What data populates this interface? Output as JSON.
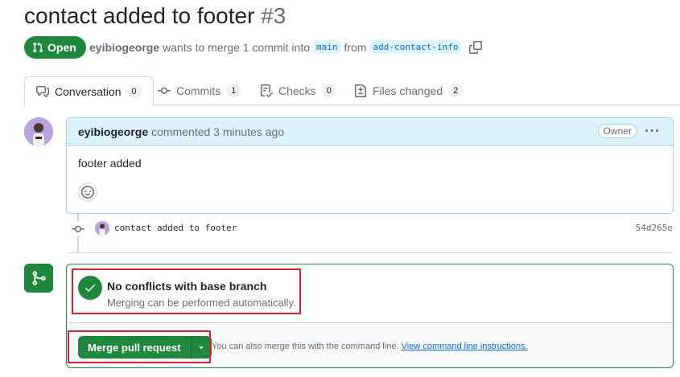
{
  "pr": {
    "title": "contact added to footer",
    "number": "#3",
    "state": "Open",
    "author": "eyibiogeorge",
    "merge_text": "wants to merge 1 commit into",
    "base_branch": "main",
    "from_text": "from",
    "head_branch": "add-contact-info"
  },
  "tabs": [
    {
      "label": "Conversation",
      "count": "0",
      "icon": "comment-discussion-icon"
    },
    {
      "label": "Commits",
      "count": "1",
      "icon": "git-commit-icon"
    },
    {
      "label": "Checks",
      "count": "0",
      "icon": "checklist-icon"
    },
    {
      "label": "Files changed",
      "count": "2",
      "icon": "file-diff-icon"
    }
  ],
  "comment": {
    "author": "eyibiogeorge",
    "action": "commented 3 minutes ago",
    "role": "Owner",
    "body": "footer added"
  },
  "commit": {
    "message": "contact added to footer",
    "sha": "54d265e"
  },
  "merge": {
    "status_title": "No conflicts with base branch",
    "status_subtitle": "Merging can be performed automatically.",
    "button_label": "Merge pull request",
    "cmdline_text": "You can also merge this with the command line.",
    "cmdline_link": "View command line instructions."
  },
  "colors": {
    "success": "#1f883d",
    "link": "#0969da",
    "highlight": "#d1242f"
  }
}
